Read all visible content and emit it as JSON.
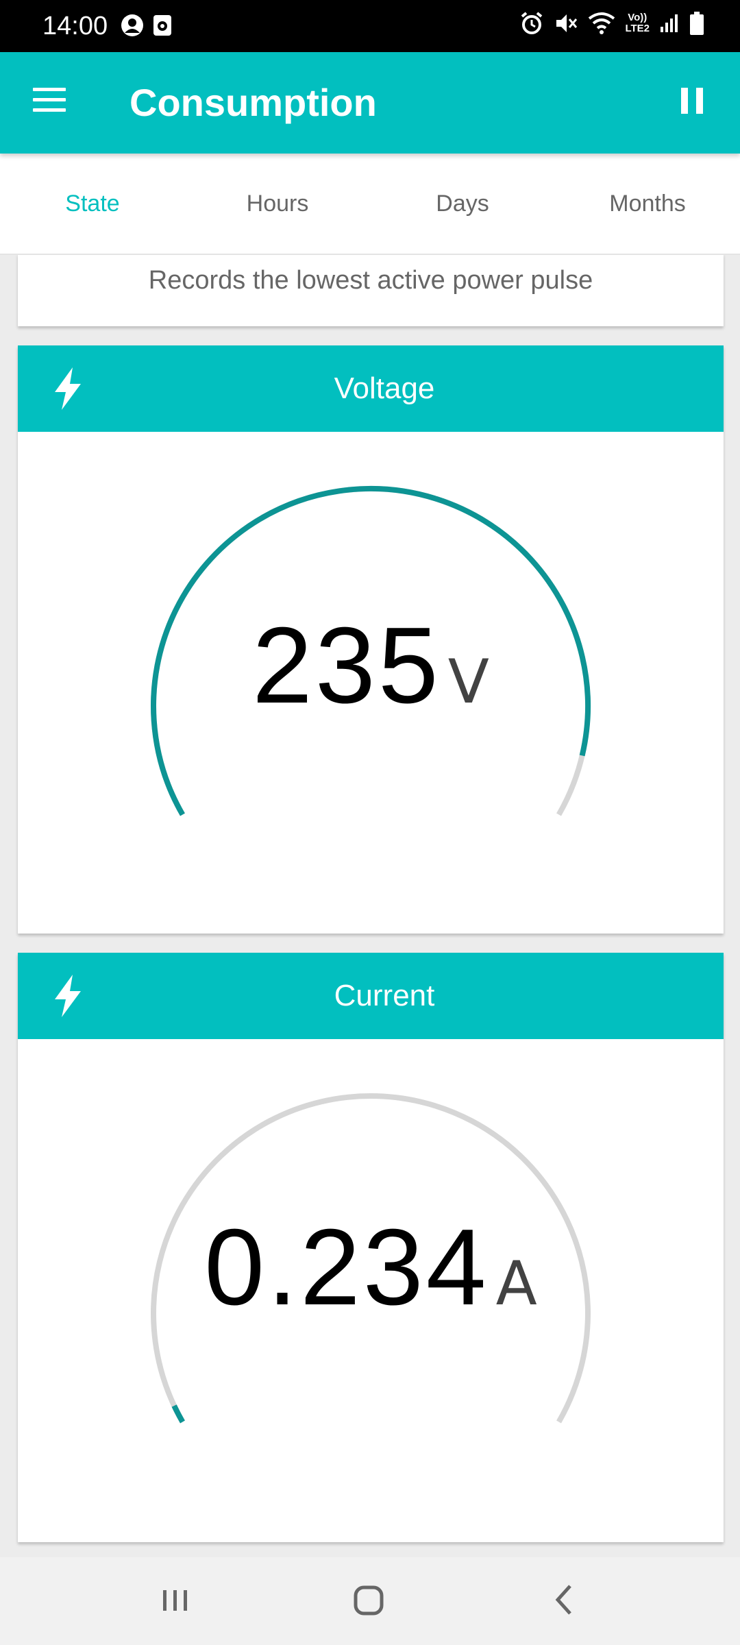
{
  "status_bar": {
    "time": "14:00",
    "left_icons": [
      "account-circle-icon",
      "screen-record-icon"
    ],
    "right_icons": [
      "alarm-icon",
      "mute-vibrate-icon",
      "wifi-icon",
      "volte-lte2-icon",
      "signal-icon",
      "battery-icon"
    ],
    "volte_label": "Vo))",
    "lte_label": "LTE2"
  },
  "app_bar": {
    "title": "Consumption",
    "menu_icon": "hamburger-menu-icon",
    "pause_icon": "pause-icon"
  },
  "tabs": [
    {
      "label": "State",
      "active": true
    },
    {
      "label": "Hours",
      "active": false
    },
    {
      "label": "Days",
      "active": false
    },
    {
      "label": "Months",
      "active": false
    }
  ],
  "partial_card": {
    "text": "Records the lowest active power pulse"
  },
  "voltage_card": {
    "title": "Voltage",
    "icon": "lightning-bolt-icon",
    "value": "235",
    "unit": "V",
    "fill_fraction": 0.93
  },
  "current_card": {
    "title": "Current",
    "icon": "lightning-bolt-icon",
    "value": "0.234",
    "unit": "A",
    "fill_fraction": 0.02
  },
  "colors": {
    "accent": "#02bfbf",
    "gauge_fill": "#0d9494",
    "gauge_track": "#d6d6d6"
  },
  "nav_bar": {
    "icons": [
      "recent-apps-icon",
      "home-icon",
      "back-icon"
    ]
  }
}
